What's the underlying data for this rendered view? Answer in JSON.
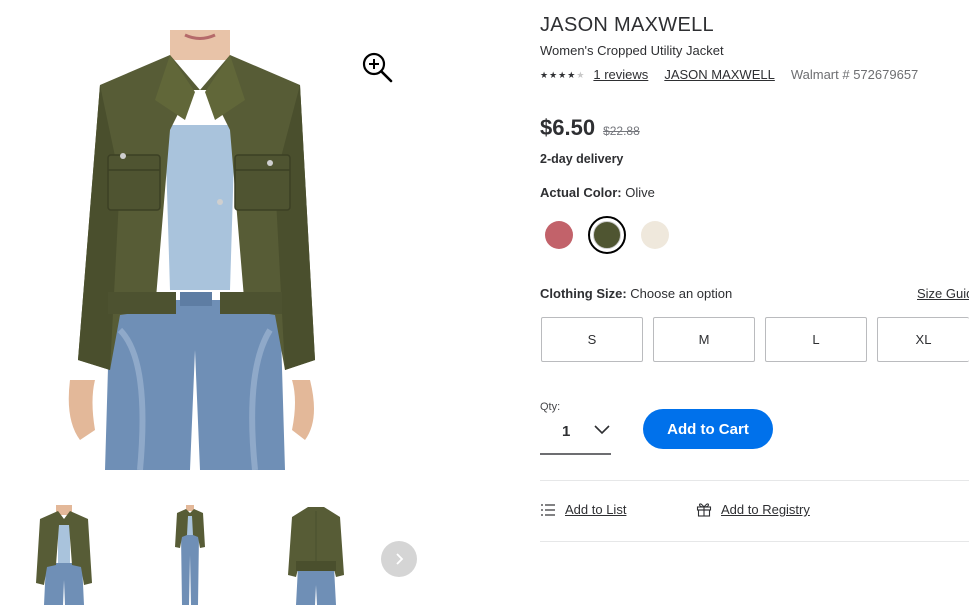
{
  "gallery": {
    "zoom_icon": "zoom-in-icon",
    "next_icon": "chevron-right-icon",
    "thumbnails": [
      "front-view",
      "full-body-view",
      "back-view"
    ]
  },
  "product": {
    "brand": "JASON MAXWELL",
    "name": "Women's Cropped Utility Jacket",
    "rating": 4,
    "rating_max": 5,
    "reviews_link": "1 reviews",
    "brand_link": "JASON MAXWELL",
    "item_number": "Walmart # 572679657",
    "price": "$6.50",
    "was_price": "$22.88",
    "delivery": "2-day delivery"
  },
  "color": {
    "label": "Actual Color:",
    "value": "Olive",
    "swatches": [
      {
        "name": "rose",
        "hex": "#c2626a",
        "selected": false
      },
      {
        "name": "olive",
        "hex": "#4f5531",
        "selected": true
      },
      {
        "name": "ivory",
        "hex": "#efe8dc",
        "selected": false
      }
    ]
  },
  "size": {
    "label": "Clothing Size:",
    "value": "Choose an option",
    "guide_link": "Size Guid",
    "options": [
      "S",
      "M",
      "L",
      "XL"
    ]
  },
  "quantity": {
    "label": "Qty:",
    "value": "1"
  },
  "actions": {
    "add_to_cart": "Add to Cart",
    "add_to_list": "Add to List",
    "add_to_registry": "Add to Registry"
  },
  "colors": {
    "primary_blue": "#0071eb",
    "text": "#2e2f32",
    "muted": "#6d6e71"
  }
}
